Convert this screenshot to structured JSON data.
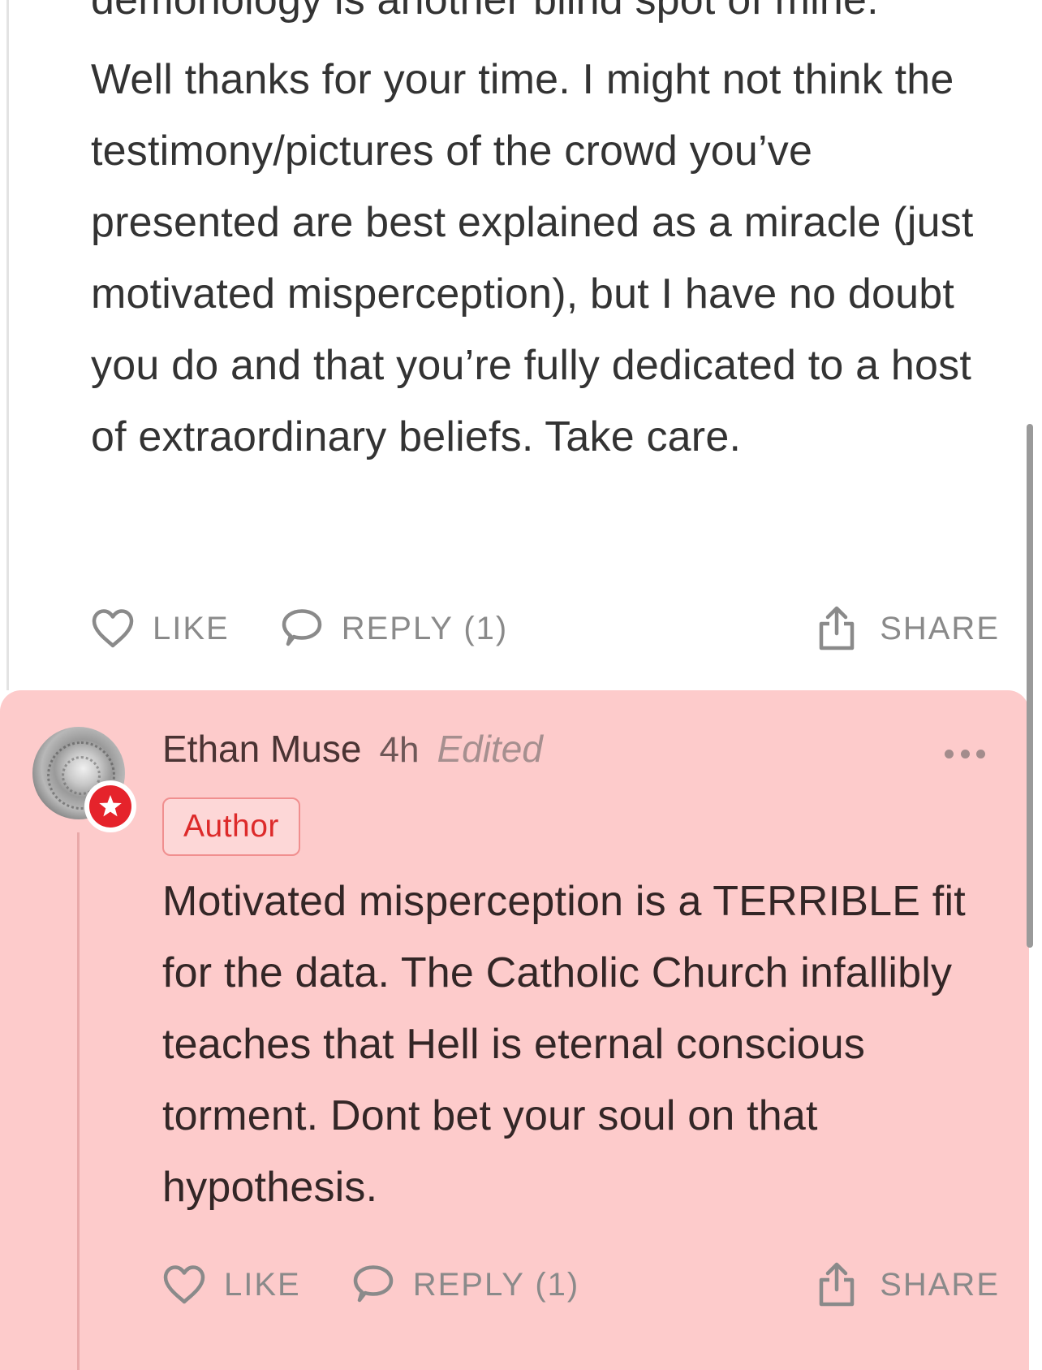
{
  "parent_comment": {
    "paragraphs": [
      "demonology is another blind spot of mine.",
      "Well thanks for your time. I might not think the testimony/pictures of the crowd you’ve presented are best explained as a miracle (just motivated misperception), but I have no doubt you do and that you’re fully dedicated to a host of extraordinary beliefs. Take care."
    ],
    "actions": {
      "like_label": "LIKE",
      "reply_label": "REPLY (1)",
      "share_label": "SHARE"
    }
  },
  "reply": {
    "author": "Ethan Muse",
    "time": "4h",
    "edited_label": "Edited",
    "badge_label": "Author",
    "body": "Motivated misperception is a TERRIBLE fit for the data. The Catholic Church infallibly teaches that Hell is eternal conscious torment. Dont bet your soul on that hypothesis.",
    "highlight_color": "#fdcbcb",
    "badge_color": "#e5232b",
    "actions": {
      "like_label": "LIKE",
      "reply_label": "REPLY (1)",
      "share_label": "SHARE"
    }
  },
  "icons": {
    "like": "heart-icon",
    "reply": "speech-bubble-icon",
    "share": "share-upload-icon",
    "more": "more-dots-icon",
    "author_star": "star-icon"
  }
}
